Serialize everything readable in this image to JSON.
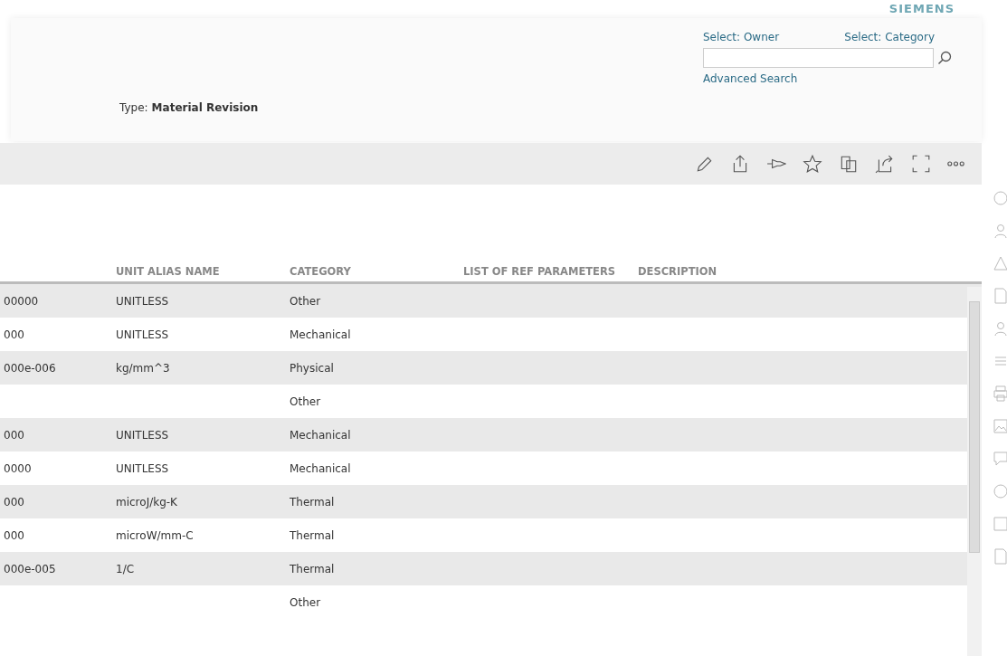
{
  "logo": "SIEMENS",
  "search": {
    "owner_link": "Select: Owner",
    "category_link": "Select: Category",
    "advanced_link": "Advanced Search"
  },
  "type": {
    "label": "Type:",
    "value": "Material Revision"
  },
  "table": {
    "columns": [
      "UNIT ALIAS NAME",
      "CATEGORY",
      "LIST OF REF PARAMETERS",
      "DESCRIPTION"
    ],
    "rows": [
      {
        "column_1": "00000",
        "unit": "UNITLESS",
        "category": "Other"
      },
      {
        "column_1": "000",
        "unit": "UNITLESS",
        "category": "Mechanical"
      },
      {
        "column_1": "000e-006",
        "unit": "kg/mm^3",
        "category": "Physical"
      },
      {
        "category": "Other"
      },
      {
        "column_1": "000",
        "unit": "UNITLESS",
        "category": "Mechanical"
      },
      {
        "column_1": "0000",
        "unit": "UNITLESS",
        "category": "Mechanical"
      },
      {
        "column_1": "000",
        "unit": "microJ/kg-K",
        "category": "Thermal"
      },
      {
        "column_1": "000",
        "unit": "microW/mm-C",
        "category": "Thermal"
      },
      {
        "column_1": "000e-005",
        "unit": "1/C",
        "category": "Thermal"
      },
      {
        "category": "Other"
      }
    ]
  }
}
